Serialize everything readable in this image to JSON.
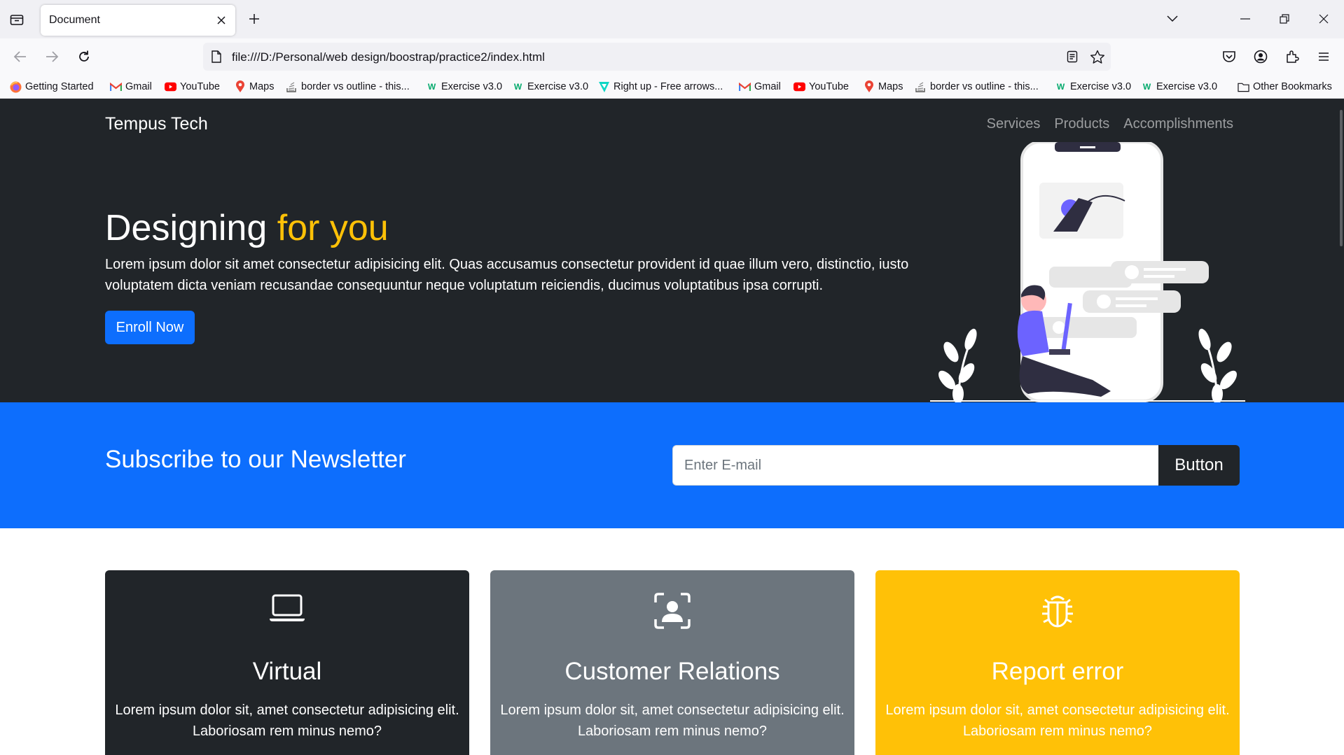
{
  "browser": {
    "tab_title": "Document",
    "url": "file:///D:/Personal/web design/boostrap/practice2/index.html",
    "bookmarks": [
      {
        "label": "Getting Started",
        "icon": "firefox-icon"
      },
      {
        "label": "Gmail",
        "icon": "gmail-icon"
      },
      {
        "label": "YouTube",
        "icon": "youtube-icon"
      },
      {
        "label": "Maps",
        "icon": "maps-icon"
      },
      {
        "label": "border vs outline - this...",
        "icon": "stackoverflow-icon"
      },
      {
        "label": "Exercise v3.0",
        "icon": "w3schools-icon"
      },
      {
        "label": "Exercise v3.0",
        "icon": "w3schools-icon"
      },
      {
        "label": "Right up - Free arrows...",
        "icon": "flaticon-icon"
      },
      {
        "label": "Gmail",
        "icon": "gmail-icon"
      },
      {
        "label": "YouTube",
        "icon": "youtube-icon"
      },
      {
        "label": "Maps",
        "icon": "maps-icon"
      },
      {
        "label": "border vs outline - this...",
        "icon": "stackoverflow-icon"
      },
      {
        "label": "Exercise v3.0",
        "icon": "w3schools-icon"
      },
      {
        "label": "Exercise v3.0",
        "icon": "w3schools-icon"
      }
    ],
    "other_bookmarks": "Other Bookmarks"
  },
  "site": {
    "brand": "Tempus Tech",
    "nav": [
      "Services",
      "Products",
      "Accomplishments"
    ],
    "hero": {
      "title_main": "Designing",
      "title_accent": "for you",
      "text": "Lorem ipsum dolor sit amet consectetur adipisicing elit. Quas accusamus consectetur provident id quae illum vero, distinctio, iusto voluptatem dicta veniam recusandae consequuntur neque voluptatum reiciendis, ducimus voluptatibus ipsa corrupti.",
      "button": "Enroll Now"
    },
    "newsletter": {
      "title": "Subscribe to our Newsletter",
      "placeholder": "Enter E-mail",
      "button": "Button"
    },
    "cards": [
      {
        "title": "Virtual",
        "text": "Lorem ipsum dolor sit, amet consectetur adipisicing elit. Laboriosam rem minus nemo?",
        "icon": "laptop-icon",
        "bg": "#212529",
        "color": "#ffffff"
      },
      {
        "title": "Customer Relations",
        "text": "Lorem ipsum dolor sit, amet consectetur adipisicing elit. Laboriosam rem minus nemo?",
        "icon": "person-bounding-box-icon",
        "bg": "#6c757d",
        "color": "#ffffff"
      },
      {
        "title": "Report error",
        "text": "Lorem ipsum dolor sit, amet consectetur adipisicing elit. Laboriosam rem minus nemo?",
        "icon": "bug-icon",
        "bg": "#ffc107",
        "color": "#ffffff"
      }
    ]
  },
  "colors": {
    "primary": "#0d6efd",
    "dark": "#212529",
    "warning": "#ffc107",
    "secondary": "#6c757d"
  }
}
